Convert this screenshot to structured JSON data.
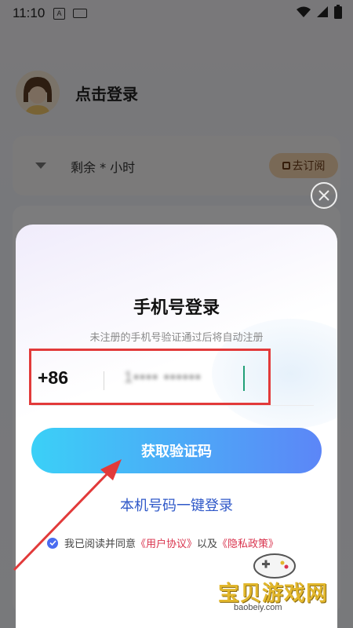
{
  "status": {
    "time": "11:10",
    "a_badge": "A"
  },
  "profile": {
    "login_label": "点击登录"
  },
  "subscription": {
    "remaining": "剩余 * 小时",
    "button": "去订阅"
  },
  "modal": {
    "title": "手机号登录",
    "subtitle": "未注册的手机号验证通过后将自动注册",
    "country_code": "+86",
    "phone_value": "1•••• ••••••",
    "get_code_button": "获取验证码",
    "one_key_login": "本机号码一键登录",
    "agreement": {
      "prefix": "我已阅读并同意",
      "user_agreement": "《用户协议》",
      "and": "以及",
      "privacy_policy": "《隐私政策》"
    }
  },
  "watermark": {
    "name": "宝贝游戏网",
    "url": "baobeiy.com"
  },
  "colors": {
    "accent_gradient_start": "#3bd0f7",
    "accent_gradient_end": "#5c86f7",
    "link_blue": "#2f58c8",
    "link_red": "#d9334d",
    "highlight_red": "#e23a3a"
  }
}
